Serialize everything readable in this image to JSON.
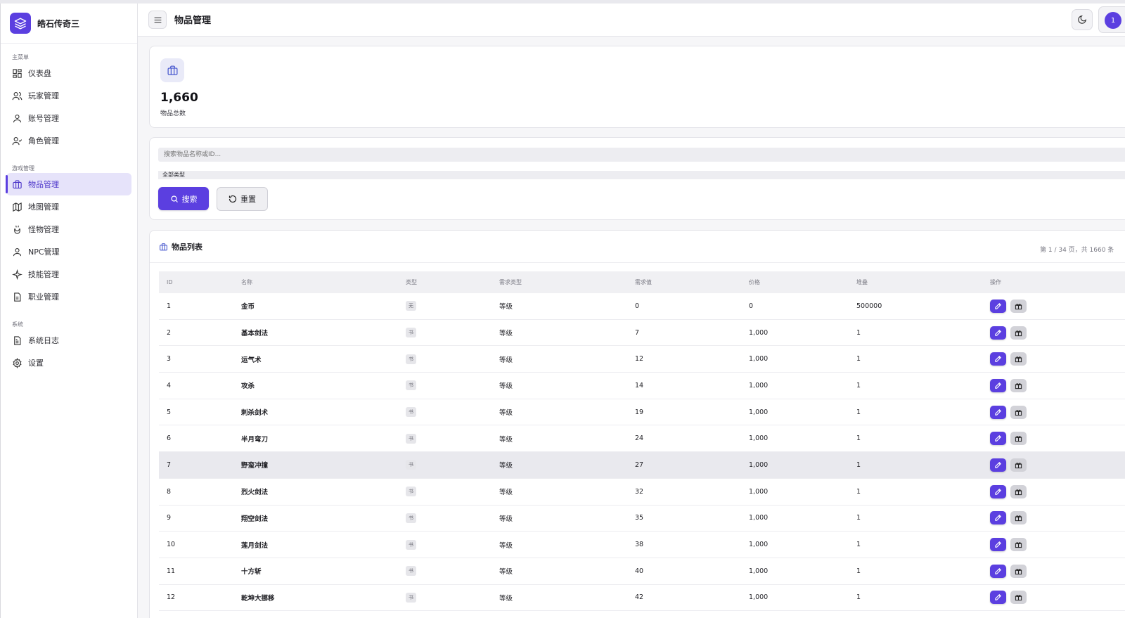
{
  "app": {
    "name": "皓石传奇三"
  },
  "sidebar": {
    "sections": [
      {
        "label": "主菜单",
        "items": [
          {
            "label": "仪表盘",
            "icon": "dashboard-icon"
          },
          {
            "label": "玩家管理",
            "icon": "users-icon"
          },
          {
            "label": "账号管理",
            "icon": "user-icon"
          },
          {
            "label": "角色管理",
            "icon": "user-check-icon"
          }
        ]
      },
      {
        "label": "游戏管理",
        "items": [
          {
            "label": "物品管理",
            "icon": "briefcase-icon",
            "active": true
          },
          {
            "label": "地图管理",
            "icon": "map-icon"
          },
          {
            "label": "怪物管理",
            "icon": "monster-icon"
          },
          {
            "label": "NPC管理",
            "icon": "person-icon"
          },
          {
            "label": "技能管理",
            "icon": "sparkle-icon"
          },
          {
            "label": "职业管理",
            "icon": "file-icon"
          }
        ]
      },
      {
        "label": "系统",
        "items": [
          {
            "label": "系统日志",
            "icon": "document-icon"
          },
          {
            "label": "设置",
            "icon": "gear-icon"
          }
        ]
      }
    ]
  },
  "header": {
    "title": "物品管理",
    "avatar_text": "1"
  },
  "stats": {
    "value": "1,660",
    "label": "物品总数"
  },
  "filters": {
    "search_placeholder": "搜索物品名称或ID...",
    "type_selected": "全部类型",
    "search_label": "搜索",
    "reset_label": "重置"
  },
  "list": {
    "title": "物品列表",
    "page_info": "第 1 / 34 页，共 1660 条",
    "columns": [
      "ID",
      "名称",
      "类型",
      "需求类型",
      "需求值",
      "价格",
      "堆叠",
      "操作"
    ],
    "rows": [
      {
        "id": "1",
        "name": "金币",
        "type": "无",
        "req_type": "等级",
        "req_val": "0",
        "price": "0",
        "stack": "500000"
      },
      {
        "id": "2",
        "name": "基本剑法",
        "type": "书",
        "req_type": "等级",
        "req_val": "7",
        "price": "1,000",
        "stack": "1"
      },
      {
        "id": "3",
        "name": "运气术",
        "type": "书",
        "req_type": "等级",
        "req_val": "12",
        "price": "1,000",
        "stack": "1"
      },
      {
        "id": "4",
        "name": "攻杀",
        "type": "书",
        "req_type": "等级",
        "req_val": "14",
        "price": "1,000",
        "stack": "1"
      },
      {
        "id": "5",
        "name": "刺杀剑术",
        "type": "书",
        "req_type": "等级",
        "req_val": "19",
        "price": "1,000",
        "stack": "1"
      },
      {
        "id": "6",
        "name": "半月弯刀",
        "type": "书",
        "req_type": "等级",
        "req_val": "24",
        "price": "1,000",
        "stack": "1"
      },
      {
        "id": "7",
        "name": "野蛮冲撞",
        "type": "书",
        "req_type": "等级",
        "req_val": "27",
        "price": "1,000",
        "stack": "1"
      },
      {
        "id": "8",
        "name": "烈火剑法",
        "type": "书",
        "req_type": "等级",
        "req_val": "32",
        "price": "1,000",
        "stack": "1"
      },
      {
        "id": "9",
        "name": "翔空剑法",
        "type": "书",
        "req_type": "等级",
        "req_val": "35",
        "price": "1,000",
        "stack": "1"
      },
      {
        "id": "10",
        "name": "莲月剑法",
        "type": "书",
        "req_type": "等级",
        "req_val": "38",
        "price": "1,000",
        "stack": "1"
      },
      {
        "id": "11",
        "name": "十方斩",
        "type": "书",
        "req_type": "等级",
        "req_val": "40",
        "price": "1,000",
        "stack": "1"
      },
      {
        "id": "12",
        "name": "乾坤大挪移",
        "type": "书",
        "req_type": "等级",
        "req_val": "42",
        "price": "1,000",
        "stack": "1"
      }
    ]
  },
  "colors": {
    "accent": "#5b3fe0",
    "active_bg": "#e6e3fa"
  }
}
